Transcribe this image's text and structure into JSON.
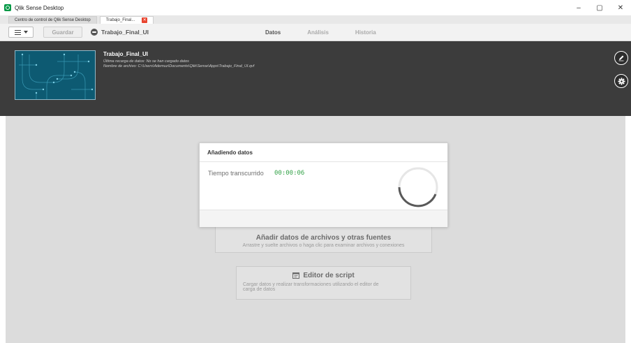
{
  "window": {
    "title": "Qlik Sense Desktop",
    "minimize_glyph": "–",
    "maximize_glyph": "▢",
    "close_glyph": "✕"
  },
  "tabs": [
    {
      "label": "Centro de control de Qlik Sense Desktop",
      "active": false
    },
    {
      "label": "Trabajo_Final...",
      "active": true,
      "close_glyph": "✕"
    }
  ],
  "toolbar": {
    "save_label": "Guardar",
    "app_name": "Trabajo_Final_UI",
    "nav": [
      {
        "label": "Datos",
        "active": true
      },
      {
        "label": "Análisis",
        "active": false
      },
      {
        "label": "Historia",
        "active": false
      }
    ]
  },
  "header": {
    "title": "Trabajo_Final_UI",
    "last_reload": "Última recarga de datos: No se han cargado datos",
    "file_name": "Nombre de archivo: C:\\Users\\Ademuz\\Documents\\Qlik\\Sense\\Apps\\Trabajo_Final_UI.qvf",
    "edit_icon": "pencil-icon",
    "settings_icon": "gear-icon"
  },
  "cards": {
    "add_data": {
      "title": "Añadir datos de archivos y otras fuentes",
      "description": "Arrastre y suelte archivos o haga clic para examinar archivos y conexiones"
    },
    "script_editor": {
      "title": "Editor de script",
      "description_line1": "Cargar datos y realizar transformaciones utilizando el editor de",
      "description_line2": "carga de datos",
      "icon": "script-icon"
    }
  },
  "modal": {
    "title": "Añadiendo datos",
    "elapsed_label": "Tiempo transcurrido",
    "elapsed_time": "00:00:06"
  },
  "colors": {
    "brand_green": "#009845",
    "header_bg": "#3c3c3c",
    "timer_green": "#35a349",
    "tab_close_red": "#e8442f",
    "thumbnail_teal": "#0d5a72"
  }
}
